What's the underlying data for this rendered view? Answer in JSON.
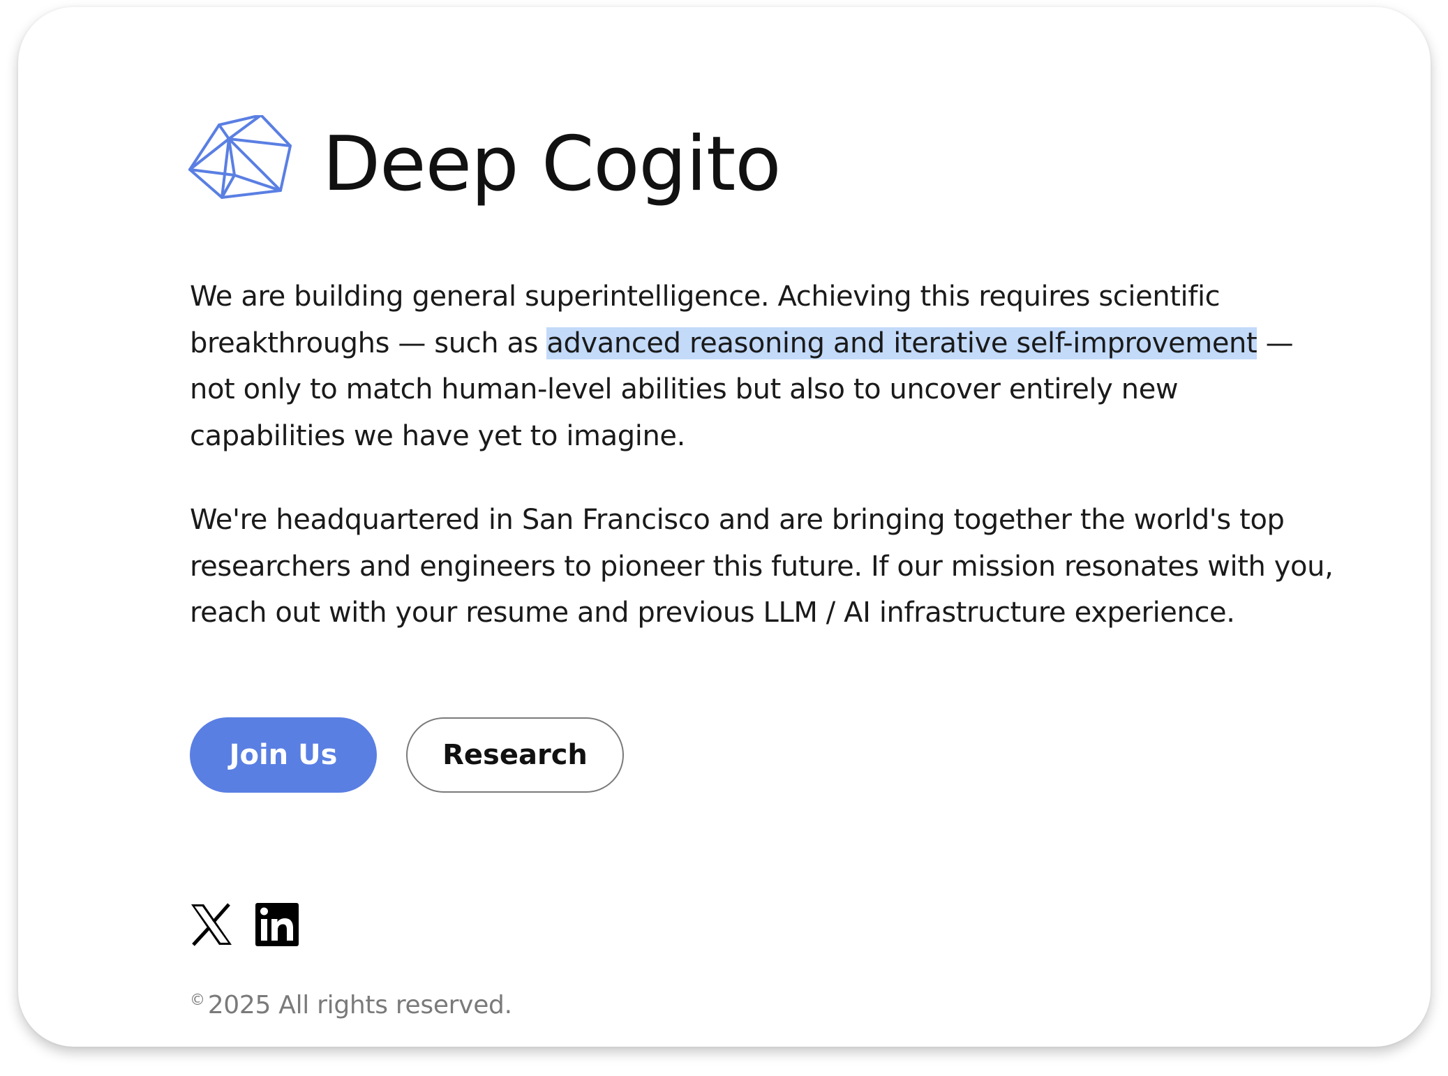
{
  "brand": {
    "name": "Deep Cogito",
    "logo_icon": "geodesic-polyhedron-icon",
    "accent_color": "#5a7fe3"
  },
  "about": {
    "p1_before": "We are building general superintelligence. Achieving this requires scientific breakthroughs — such as ",
    "p1_highlight": "advanced reasoning and iterative self-improvement",
    "p1_after": " — not only to match human-level abilities but also to uncover entirely new capabilities we have yet to imagine.",
    "p2": "We're headquartered in San Francisco and are bringing together the world's top researchers and engineers to pioneer this future. If our mission resonates with you, reach out with your resume and previous LLM / AI infrastructure experience."
  },
  "actions": {
    "join_label": "Join Us",
    "research_label": "Research"
  },
  "social": {
    "icons": [
      "x-icon",
      "linkedin-icon"
    ]
  },
  "footer": {
    "copyright_symbol": "©",
    "copyright_text": "2025 All rights reserved."
  }
}
